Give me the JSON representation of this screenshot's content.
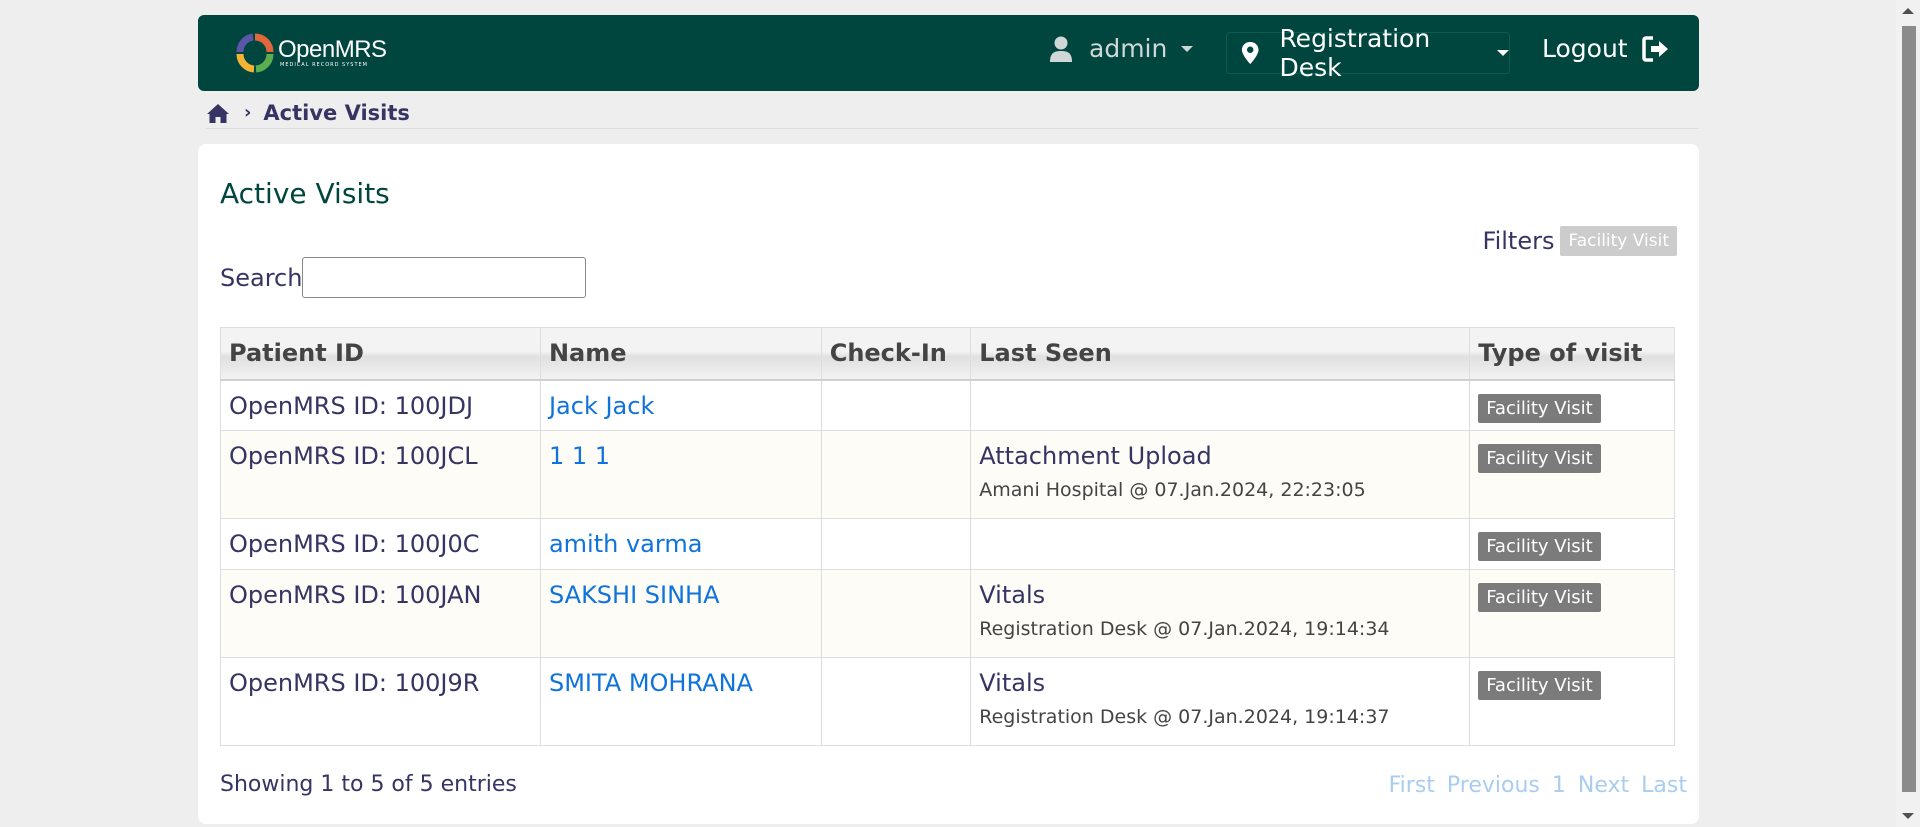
{
  "header": {
    "logo_text": "OpenMRS",
    "logo_subtext": "MEDICAL RECORD SYSTEM",
    "user": "admin",
    "location": "Registration Desk",
    "logout_label": "Logout"
  },
  "breadcrumb": {
    "current": "Active Visits"
  },
  "main": {
    "title": "Active Visits",
    "filters_label": "Filters",
    "filter_badge": "Facility Visit",
    "search_label": "Search",
    "search_value": "",
    "columns": [
      "Patient ID",
      "Name",
      "Check-In",
      "Last Seen",
      "Type of visit"
    ],
    "rows": [
      {
        "patient_id": "OpenMRS ID: 100JDJ",
        "name": "Jack Jack",
        "check_in": "",
        "last_seen": "",
        "last_seen_detail": "",
        "visit_type": "Facility Visit"
      },
      {
        "patient_id": "OpenMRS ID: 100JCL",
        "name": "1 1 1",
        "check_in": "",
        "last_seen": "Attachment Upload",
        "last_seen_detail": "Amani Hospital @ 07.Jan.2024, 22:23:05",
        "visit_type": "Facility Visit"
      },
      {
        "patient_id": "OpenMRS ID: 100J0C",
        "name": "amith varma",
        "check_in": "",
        "last_seen": "",
        "last_seen_detail": "",
        "visit_type": "Facility Visit"
      },
      {
        "patient_id": "OpenMRS ID: 100JAN",
        "name": "SAKSHI SINHA",
        "check_in": "",
        "last_seen": "Vitals",
        "last_seen_detail": "Registration Desk @ 07.Jan.2024, 19:14:34",
        "visit_type": "Facility Visit"
      },
      {
        "patient_id": "OpenMRS ID: 100J9R",
        "name": "SMITA MOHRANA",
        "check_in": "",
        "last_seen": "Vitals",
        "last_seen_detail": "Registration Desk @ 07.Jan.2024, 19:14:37",
        "visit_type": "Facility Visit"
      }
    ],
    "showing_text": "Showing 1 to 5 of 5 entries",
    "pager": {
      "first": "First",
      "previous": "Previous",
      "page": "1",
      "next": "Next",
      "last": "Last"
    }
  },
  "colors": {
    "header_bg": "#00463f",
    "link": "#0f73db",
    "badge": "#7b7b7b",
    "pager_disabled": "#a9cdf0"
  },
  "icons": [
    "openmrs-logo",
    "user-icon",
    "pin-icon",
    "logout-icon",
    "home-icon"
  ]
}
